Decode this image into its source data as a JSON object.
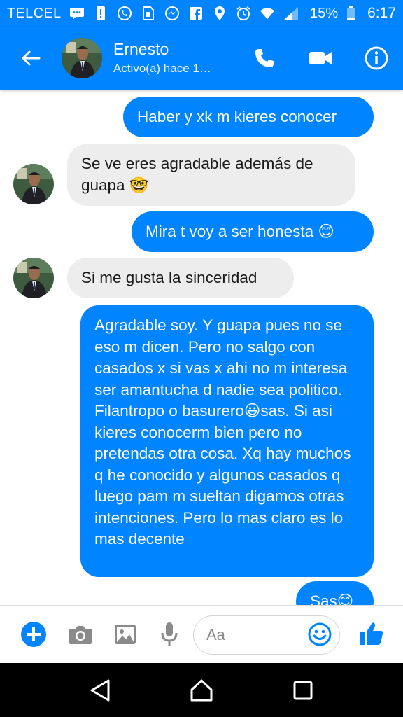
{
  "status_bar": {
    "carrier": "TELCEL",
    "battery": "15%",
    "time": "6:17",
    "icons": [
      "sms-icon",
      "alert-icon",
      "whatsapp-icon",
      "sim-icon",
      "messenger-icon",
      "facebook-icon",
      "location-icon",
      "alarm-icon",
      "wifi-icon",
      "signal-icon",
      "battery-icon"
    ]
  },
  "header": {
    "contact_name": "Ernesto",
    "contact_status": "Activo(a) hace 1…",
    "back_icon": "back-arrow-icon",
    "call_icon": "phone-icon",
    "video_icon": "video-camera-icon",
    "info_icon": "info-icon"
  },
  "messages": [
    {
      "direction": "sent",
      "text": "Haber y xk m kieres conocer"
    },
    {
      "direction": "received",
      "text": "Se ve eres agradable además de guapa 🤓"
    },
    {
      "direction": "sent",
      "text": "Mira t voy a ser honesta 😊"
    },
    {
      "direction": "received",
      "text": "Si me gusta la sinceridad"
    },
    {
      "direction": "sent",
      "text": "Agradable soy. Y guapa pues no se eso m dicen. Pero no salgo con casados x si vas x ahi no m interesa ser amantucha d nadie sea politico. Filantropo o basurero😃sas. Si asi kieres conocerm bien pero no pretendas otra cosa. Xq hay muchos q he conocido y algunos casados q luego pam m sueltan digamos otras intenciones. Pero lo mas claro es lo mas decente"
    },
    {
      "direction": "sent",
      "text": "Sas😊"
    }
  ],
  "composer": {
    "placeholder": "Aa",
    "icons": [
      "plus-icon",
      "camera-icon",
      "gallery-icon",
      "microphone-icon",
      "emoji-icon",
      "thumbs-up-icon"
    ]
  },
  "nav_bar": {
    "icons": [
      "back-triangle-icon",
      "home-icon",
      "recents-icon"
    ]
  },
  "colors": {
    "brand_blue": "#0084ff",
    "received_bubble": "#ededed",
    "nav_bar": "#000000"
  }
}
